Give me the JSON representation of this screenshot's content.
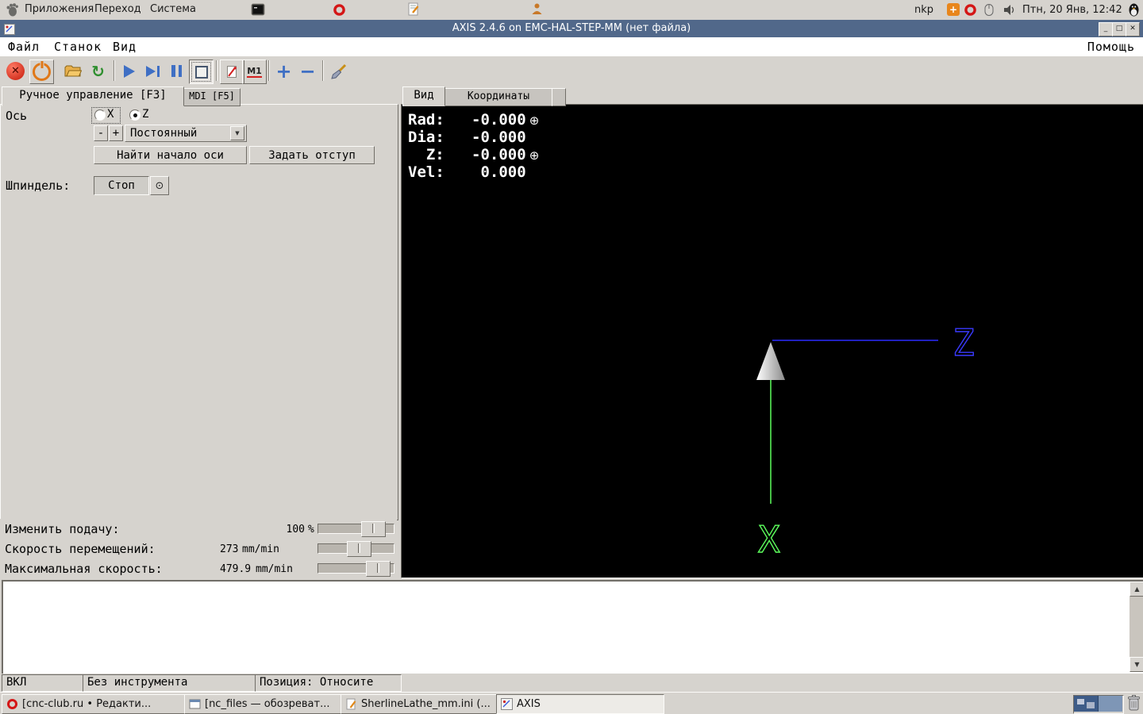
{
  "desktop": {
    "menus": [
      "Приложения",
      "Переход",
      "Система"
    ],
    "username": "nkp",
    "clock": "Птн, 20 Янв, 12:42"
  },
  "window": {
    "title": "AXIS 2.4.6 on EMC-HAL-STEP-MM (нет файла)",
    "menus": [
      "Файл",
      "Станок",
      "Вид"
    ],
    "help": "Помощь"
  },
  "toolbar": {
    "optional_stop_label": "M1"
  },
  "left_tabs": [
    "Ручное управление [F3]",
    "MDI [F5]"
  ],
  "manual": {
    "axis_label": "Ось",
    "axis_x": "X",
    "axis_z": "Z",
    "selected_axis": "Z",
    "jog_minus": "-",
    "jog_plus": "+",
    "jog_mode": "Постоянный",
    "home_button": "Найти начало оси",
    "offset_button": "Задать отступ",
    "spindle_label": "Шпиндель:",
    "spindle_stop": "Стоп"
  },
  "overrides": {
    "feed": {
      "label": "Изменить подачу:",
      "value": "100",
      "unit": "%"
    },
    "jog_speed": {
      "label": "Скорость перемещений:",
      "value": "273",
      "unit": "mm/min"
    },
    "max_velocity": {
      "label": "Максимальная скорость:",
      "value": "479.9",
      "unit": "mm/min"
    }
  },
  "right_tabs": [
    "Вид",
    "Координаты"
  ],
  "dro": {
    "rad_label": "Rad:",
    "rad_value": "-0.000",
    "dia_label": "Dia:",
    "dia_value": "-0.000",
    "z_label": "Z:",
    "z_value": "-0.000",
    "vel_label": "Vel:",
    "vel_value": "0.000"
  },
  "preview": {
    "x_axis_label": "X",
    "z_axis_label": "Z",
    "colors": {
      "x_axis": "#5dff5d",
      "z_axis": "#2a2aff",
      "background": "#000000"
    }
  },
  "statusbar": {
    "power": "ВКЛ",
    "tool": "Без инструмента",
    "position": "Позиция: Относите"
  },
  "taskbar": {
    "buttons": [
      "[cnc-club.ru • Редакти...",
      "[nc_files — обозреват...",
      "SherlineLathe_mm.ini (...",
      "AXIS"
    ]
  },
  "icons": {
    "estop": "✕",
    "reload": "↻",
    "zoom_in": "+",
    "zoom_out": "−",
    "dropdown_arrow": "▼",
    "scroll_up": "▲",
    "scroll_down": "▼",
    "homed": "⊕",
    "spindle_brake": "⊙",
    "minimize": "_",
    "maximize": "□",
    "close": "✕",
    "tray_update": "+"
  }
}
